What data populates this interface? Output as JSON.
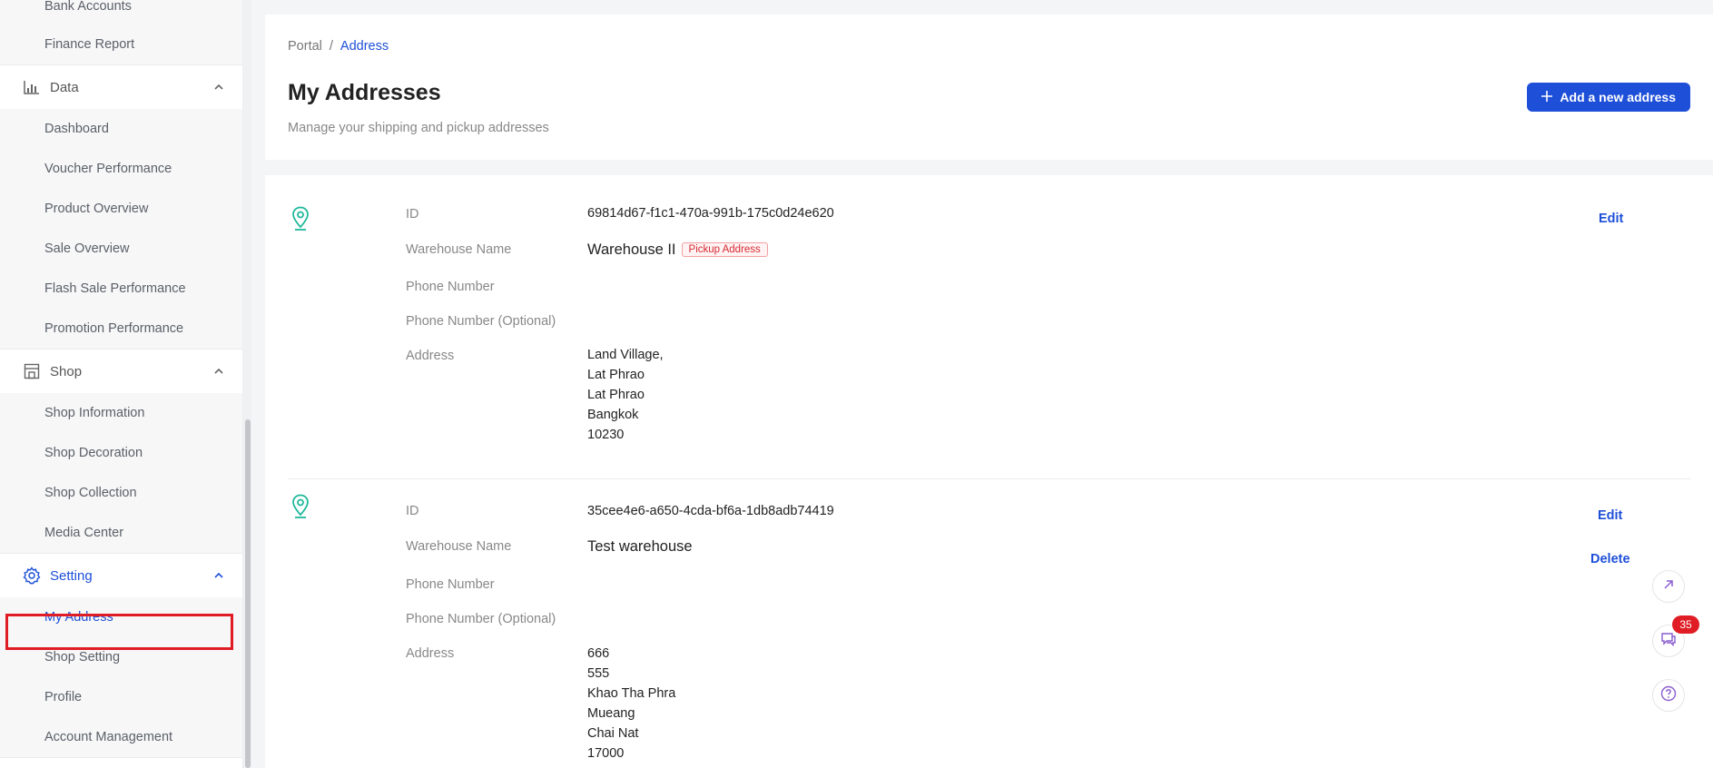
{
  "sidebar": {
    "finance_items": [
      "Bank Accounts",
      "Finance Report"
    ],
    "data_section": {
      "label": "Data",
      "items": [
        "Dashboard",
        "Voucher Performance",
        "Product Overview",
        "Sale Overview",
        "Flash Sale Performance",
        "Promotion Performance"
      ]
    },
    "shop_section": {
      "label": "Shop",
      "items": [
        "Shop Information",
        "Shop Decoration",
        "Shop Collection",
        "Media Center"
      ]
    },
    "setting_section": {
      "label": "Setting",
      "items": [
        "My Address",
        "Shop Setting",
        "Profile",
        "Account Management"
      ]
    }
  },
  "breadcrumb": {
    "root": "Portal",
    "separator": "/",
    "current": "Address"
  },
  "page": {
    "title": "My Addresses",
    "subtitle": "Manage your shipping and pickup addresses",
    "add_button": "Add a new address"
  },
  "labels": {
    "id": "ID",
    "warehouse_name": "Warehouse Name",
    "phone": "Phone Number",
    "phone_optional": "Phone Number (Optional)",
    "address": "Address",
    "edit": "Edit",
    "delete": "Delete"
  },
  "addresses": [
    {
      "id": "69814d67-f1c1-470a-991b-175c0d24e620",
      "warehouse_name": "Warehouse II",
      "tag": "Pickup Address",
      "phone": "",
      "phone_optional": "",
      "address_lines": [
        "Land Village,",
        "Lat Phrao",
        "Lat Phrao",
        "Bangkok",
        "10230"
      ]
    },
    {
      "id": "35cee4e6-a650-4cda-bf6a-1db8adb74419",
      "warehouse_name": "Test warehouse",
      "tag": "",
      "phone": "",
      "phone_optional": "",
      "address_lines": [
        "666",
        "555",
        "Khao Tha Phra",
        "Mueang",
        "Chai Nat",
        "17000"
      ]
    }
  ],
  "floating": {
    "chat_badge": "35"
  },
  "colors": {
    "primary": "#1e4fd8",
    "accent_pin": "#1fb89a",
    "danger": "#e01d25"
  },
  "icons": [
    "chart-icon",
    "shop-icon",
    "gear-icon",
    "chevron-up-icon",
    "location-pin-icon",
    "plus-icon",
    "external-link-icon",
    "chat-icon",
    "help-icon"
  ]
}
